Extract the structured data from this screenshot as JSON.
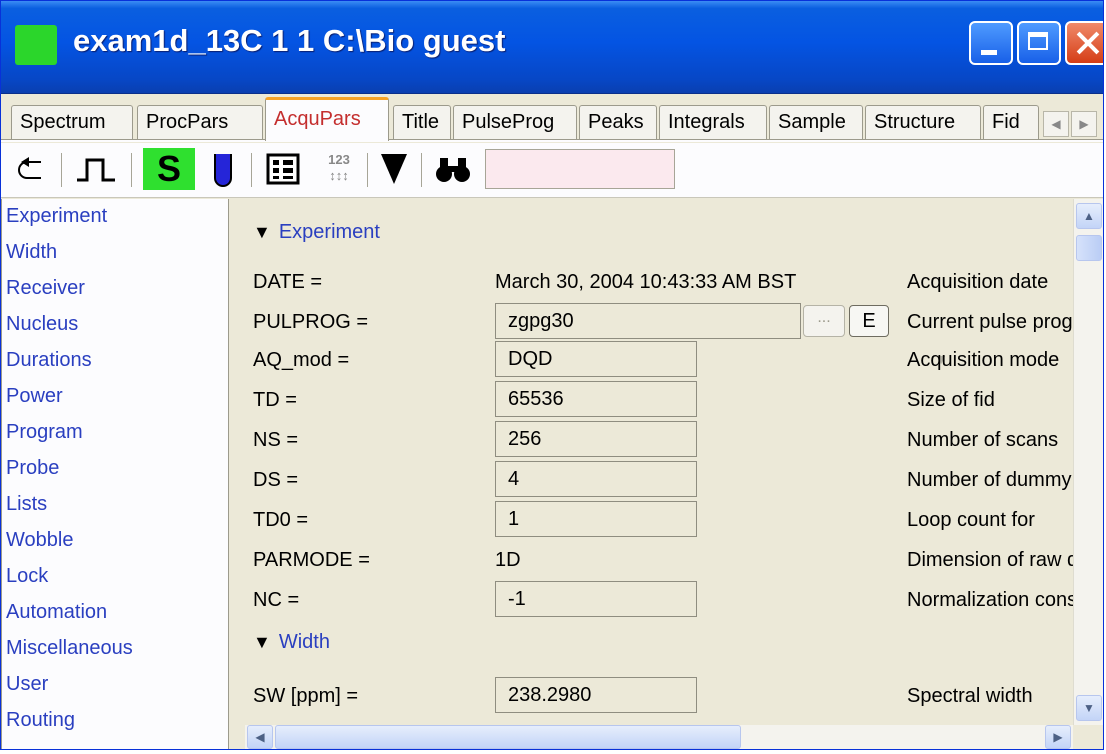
{
  "window": {
    "title": "exam1d_13C  1  1  C:\\Bio  guest",
    "controls": [
      "minimize",
      "maximize",
      "close"
    ]
  },
  "tabs": [
    {
      "label": "Spectrum",
      "active": false
    },
    {
      "label": "ProcPars",
      "active": false
    },
    {
      "label": "AcquPars",
      "active": true
    },
    {
      "label": "Title",
      "active": false
    },
    {
      "label": "PulseProg",
      "active": false
    },
    {
      "label": "Peaks",
      "active": false
    },
    {
      "label": "Integrals",
      "active": false
    },
    {
      "label": "Sample",
      "active": false
    },
    {
      "label": "Structure",
      "active": false
    },
    {
      "label": "Fid",
      "active": false
    }
  ],
  "toolbar": {
    "icons": [
      "undo-icon",
      "pulse-icon",
      "s-button",
      "probe-icon",
      "table-icon",
      "numbers-icon",
      "filter-icon",
      "binoculars-icon"
    ],
    "s_label": "S",
    "search_value": ""
  },
  "sidebar": {
    "items": [
      "Experiment",
      "Width",
      "Receiver",
      "Nucleus",
      "Durations",
      "Power",
      "Program",
      "Probe",
      "Lists",
      "Wobble",
      "Lock",
      "Automation",
      "Miscellaneous",
      "User",
      "Routing"
    ]
  },
  "main": {
    "section_experiment": "Experiment",
    "section_width": "Width",
    "params": [
      {
        "name": "DATE =",
        "value": "March 30, 2004 10:43:33 AM BST",
        "desc": "Acquisition date"
      },
      {
        "name": "PULPROG =",
        "value": "zgpg30",
        "desc": "Current pulse program"
      },
      {
        "name": "AQ_mod =",
        "value": "DQD",
        "desc": "Acquisition mode"
      },
      {
        "name": "TD =",
        "value": "65536",
        "desc": "Size of fid"
      },
      {
        "name": "NS =",
        "value": "256",
        "desc": "Number of scans"
      },
      {
        "name": "DS =",
        "value": "4",
        "desc": "Number of dummy scans"
      },
      {
        "name": "TD0 =",
        "value": "1",
        "desc": "Loop count for"
      },
      {
        "name": "PARMODE =",
        "value": "1D",
        "desc": "Dimension of raw data"
      },
      {
        "name": "NC =",
        "value": "-1",
        "desc": "Normalization constant"
      },
      {
        "name": "SW [ppm] =",
        "value": "238.2980",
        "desc": "Spectral width"
      }
    ],
    "dots_label": "...",
    "e_label": "E"
  }
}
